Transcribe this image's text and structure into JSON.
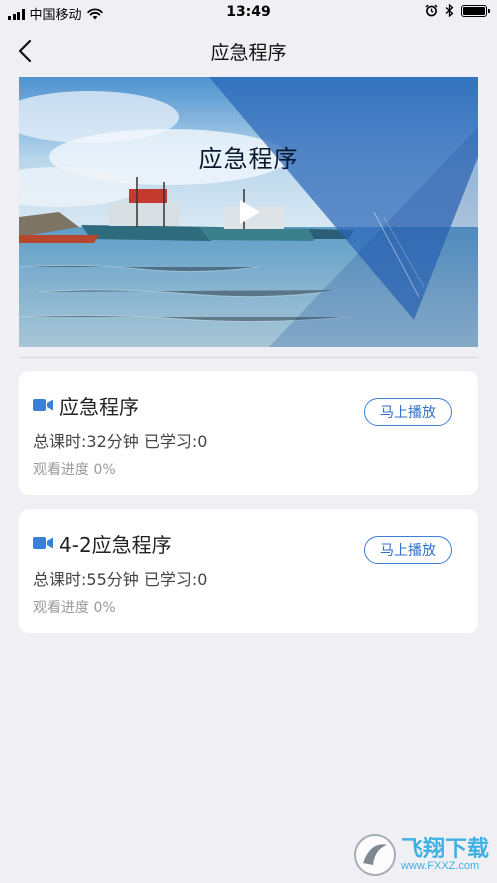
{
  "status_bar": {
    "carrier": "中国移动",
    "time": "13:49"
  },
  "nav": {
    "title": "应急程序"
  },
  "banner": {
    "title": "应急程序"
  },
  "courses": [
    {
      "title": "应急程序",
      "meta": "总课时:32分钟  已学习:0",
      "progress": "观看进度 0%",
      "button": "马上播放"
    },
    {
      "title": "4-2应急程序",
      "meta": "总课时:55分钟  已学习:0",
      "progress": "观看进度 0%",
      "button": "马上播放"
    }
  ],
  "watermark": {
    "brand": "飞翔下载",
    "url": "www.FXXZ.com"
  },
  "colors": {
    "accent": "#3a7fd8",
    "background": "#f0f0f4",
    "watermark": "#1fa6e0"
  }
}
